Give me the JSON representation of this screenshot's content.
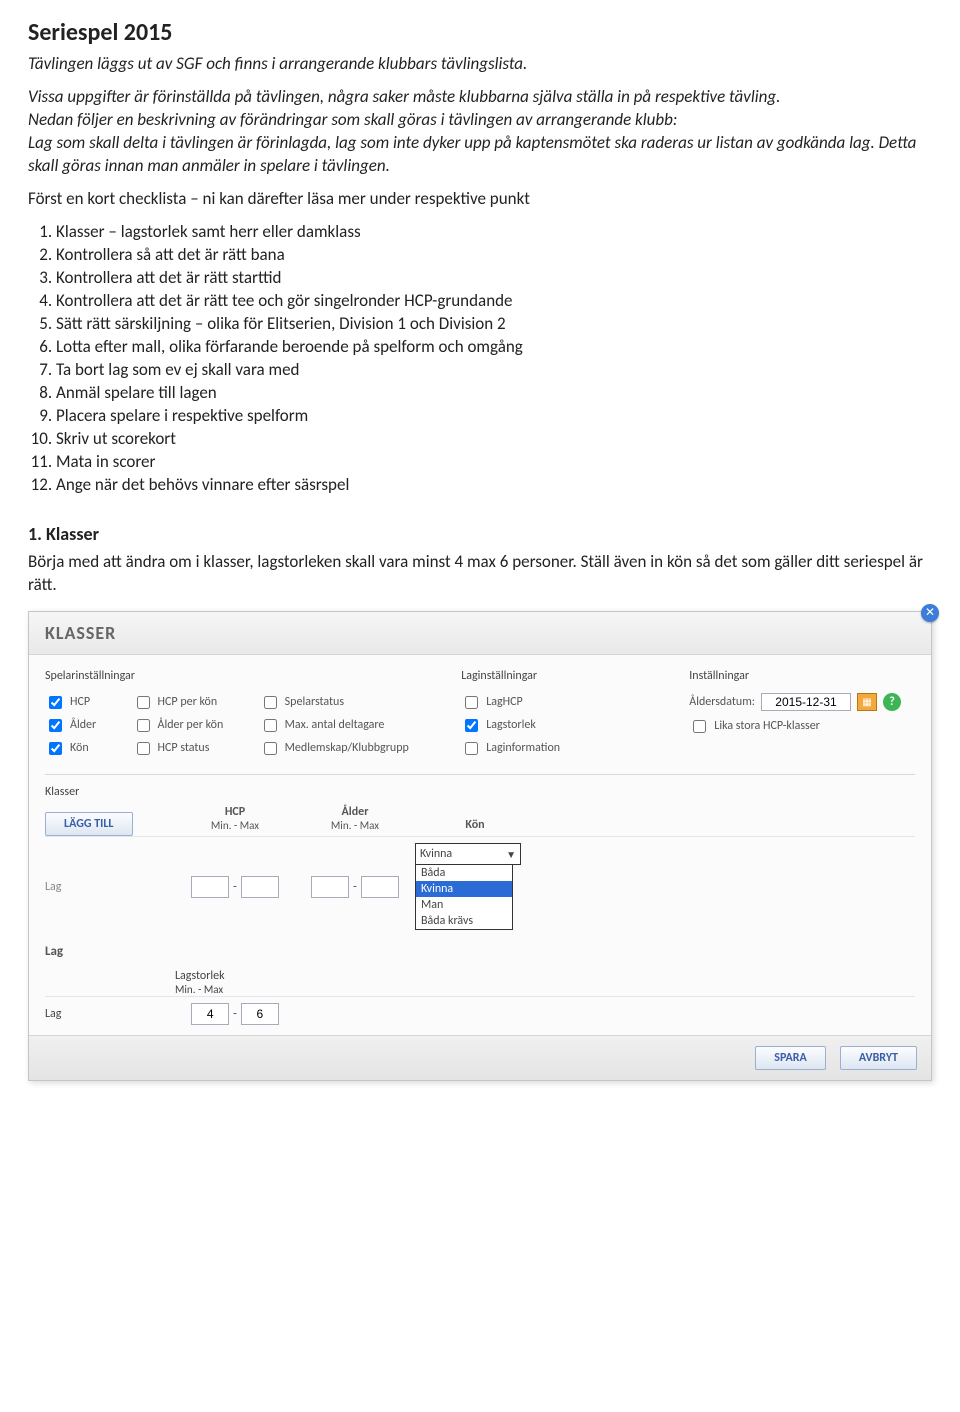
{
  "doc": {
    "title": "Seriespel 2015",
    "p1": "Tävlingen läggs ut av SGF och finns i arrangerande klubbars tävlingslista.",
    "p2a": "Vissa uppgifter är förinställda på tävlingen, några saker måste klubbarna själva ställa in på respektive tävling.",
    "p2b": "Nedan följer en beskrivning av förändringar som skall göras i tävlingen av arrangerande klubb:",
    "p2c": "Lag som skall delta i tävlingen är förinlagda, lag som inte dyker upp på kaptensmötet ska raderas ur listan av godkända lag. Detta skall göras innan man anmäler in spelare i tävlingen.",
    "intro2": "Först en kort checklista – ni kan därefter läsa mer under respektive punkt",
    "list": [
      "Klasser – lagstorlek samt herr eller damklass",
      "Kontrollera så att det är rätt bana",
      "Kontrollera att det är rätt starttid",
      "Kontrollera att det är rätt tee och gör singelronder HCP-grundande",
      "Sätt rätt särskiljning – olika för Elitserien, Division 1 och Division 2",
      "Lotta efter mall, olika förfarande beroende på spelform och omgång",
      "Ta bort lag som ev ej skall vara med",
      "Anmäl spelare till lagen",
      "Placera spelare i respektive spelform",
      "Skriv ut scorekort",
      "Mata in scorer",
      "Ange när det behövs vinnare efter säsrspel"
    ],
    "s1_title": "1. Klasser",
    "s1_body": "Börja med att ändra om i klasser, lagstorleken skall vara minst 4 max 6 personer. Ställ även in kön så det som gäller ditt seriespel är rätt."
  },
  "dialog": {
    "title": "KLASSER",
    "cols": {
      "spelar": {
        "title": "Spelarinställningar",
        "cb": {
          "hcp": "HCP",
          "hcp_kon": "HCP per kön",
          "spelarstatus": "Spelarstatus",
          "alder": "Ålder",
          "alder_kon": "Ålder per kön",
          "maxdel": "Max. antal deltagare",
          "kon": "Kön",
          "hcp_status": "HCP status",
          "medlem": "Medlemskap/Klubbgrupp"
        }
      },
      "lag": {
        "title": "Laginställningar",
        "cb": {
          "laghcp": "LagHCP",
          "lagstorlek": "Lagstorlek",
          "laginfo": "Laginformation"
        }
      },
      "inst": {
        "title": "Inställningar",
        "alderdatum_label": "Åldersdatum:",
        "alderdatum_value": "2015-12-31",
        "lika": "Lika stora HCP-klasser"
      }
    },
    "klasser_label": "Klasser",
    "add_btn": "LÄGG TILL",
    "headers": {
      "hcp": "HCP",
      "alder": "Ålder",
      "kon": "Kön",
      "minmax": "Min. - Max"
    },
    "row1": {
      "label": "Lag",
      "kon_value": "Kvinna"
    },
    "dropdown": {
      "opt1": "Båda",
      "opt2": "Kvinna",
      "opt3": "Man",
      "opt4": "Båda krävs"
    },
    "row2": {
      "label": "Lag"
    },
    "size": {
      "header": "Lagstorlek",
      "sub": "Min. - Max",
      "label": "Lag",
      "min": "4",
      "max": "6"
    },
    "footer": {
      "save": "SPARA",
      "cancel": "AVBRYT"
    }
  }
}
